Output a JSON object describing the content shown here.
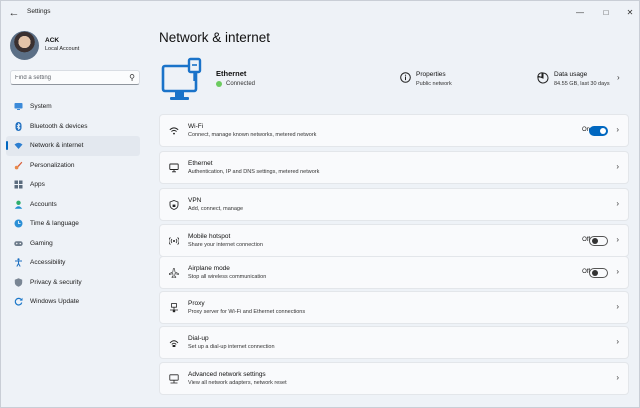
{
  "window": {
    "title": "Settings"
  },
  "user": {
    "name": "ACK",
    "account_type": "Local Account"
  },
  "search": {
    "placeholder": "Find a setting"
  },
  "sidebar": {
    "items": [
      {
        "label": "System",
        "icon": "monitor-icon",
        "active": false
      },
      {
        "label": "Bluetooth & devices",
        "icon": "bluetooth-icon",
        "active": false
      },
      {
        "label": "Network & internet",
        "icon": "wifi-icon",
        "active": true
      },
      {
        "label": "Personalization",
        "icon": "brush-icon",
        "active": false
      },
      {
        "label": "Apps",
        "icon": "apps-icon",
        "active": false
      },
      {
        "label": "Accounts",
        "icon": "person-icon",
        "active": false
      },
      {
        "label": "Time & language",
        "icon": "globe-clock-icon",
        "active": false
      },
      {
        "label": "Gaming",
        "icon": "gamepad-icon",
        "active": false
      },
      {
        "label": "Accessibility",
        "icon": "accessibility-icon",
        "active": false
      },
      {
        "label": "Privacy & security",
        "icon": "shield-icon",
        "active": false
      },
      {
        "label": "Windows Update",
        "icon": "update-icon",
        "active": false
      }
    ]
  },
  "page": {
    "title": "Network & internet"
  },
  "hero": {
    "connection_name": "Ethernet",
    "connection_status": "Connected",
    "properties_title": "Properties",
    "properties_sub": "Public network",
    "data_title": "Data usage",
    "data_sub": "84.55 GB, last 30 days"
  },
  "cards": [
    {
      "title": "Wi-Fi",
      "sub": "Connect, manage known networks, metered network",
      "icon": "wifi-icon",
      "toggle": "On"
    },
    {
      "title": "Ethernet",
      "sub": "Authentication, IP and DNS settings, metered network",
      "icon": "ethernet-icon"
    },
    {
      "title": "VPN",
      "sub": "Add, connect, manage",
      "icon": "vpn-shield-icon"
    },
    {
      "title": "Mobile hotspot",
      "sub": "Share your internet connection",
      "icon": "hotspot-icon",
      "toggle": "Off"
    },
    {
      "title": "Airplane mode",
      "sub": "Stop all wireless communication",
      "icon": "airplane-icon",
      "toggle": "Off"
    },
    {
      "title": "Proxy",
      "sub": "Proxy server for Wi-Fi and Ethernet connections",
      "icon": "proxy-icon"
    },
    {
      "title": "Dial-up",
      "sub": "Set up a dial-up internet connection",
      "icon": "dialup-icon"
    },
    {
      "title": "Advanced network settings",
      "sub": "View all network adapters, network reset",
      "icon": "network-adapter-icon"
    }
  ],
  "colors": {
    "accent": "#0067c0",
    "connected": "#6ccb5f",
    "background": "#eef2f7"
  }
}
